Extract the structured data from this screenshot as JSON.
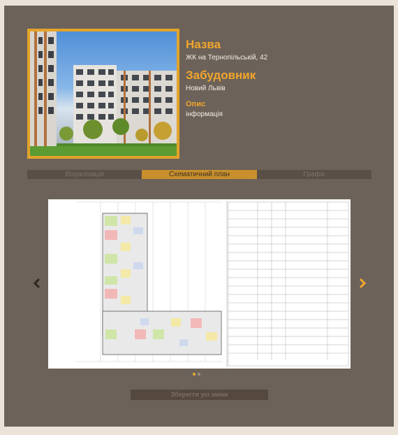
{
  "project": {
    "name_label": "Назва",
    "name_value": "ЖК на Тернопільській, 42",
    "developer_label": "Забудовник",
    "developer_value": "Новий Львів",
    "description_label": "Опис",
    "description_value": "інформація"
  },
  "tabs": [
    {
      "label": "Візуалізація",
      "active": false
    },
    {
      "label": "Схематичний план",
      "active": true
    },
    {
      "label": "Графік",
      "active": false
    }
  ],
  "carousel": {
    "slide_count": 2,
    "active_index": 0,
    "prev_icon": "chevron-left-icon",
    "next_icon": "chevron-right-icon"
  },
  "save_button_label": "Зберегти усі зміни",
  "colors": {
    "accent": "#f2a62c",
    "panel": "#6c6259",
    "page_background": "#ebe2d8",
    "tab_active": "#c88f2c",
    "tab_inactive": "#5a4f46"
  }
}
